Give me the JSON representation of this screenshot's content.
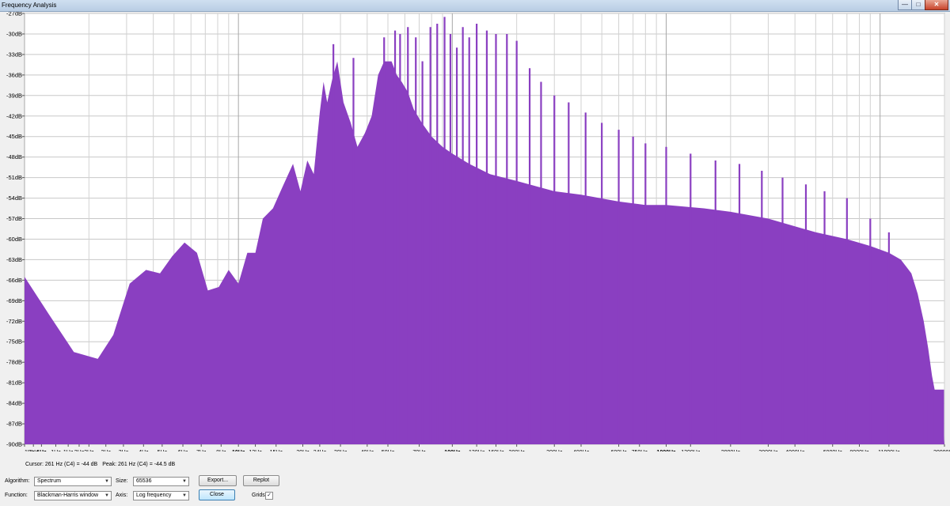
{
  "window": {
    "title": "Frequency Analysis",
    "controls": {
      "minimize": "—",
      "maximize": "□",
      "close": "✕"
    }
  },
  "chart_data": {
    "type": "area",
    "xscale": "log",
    "x_unit": "Hz",
    "y_unit": "dB",
    "ylim": [
      -90,
      -27
    ],
    "xlim": [
      1,
      20000
    ],
    "grid": true,
    "fill_color": "#8a3fc1",
    "y_ticks": [
      "-27dB",
      "-30dB",
      "-33dB",
      "-36dB",
      "-39dB",
      "-42dB",
      "-45dB",
      "-48dB",
      "-51dB",
      "-54dB",
      "-57dB",
      "-60dB",
      "-63dB",
      "-66dB",
      "-69dB",
      "-72dB",
      "-75dB",
      "-78dB",
      "-81dB",
      "-84dB",
      "-87dB",
      "-90dB"
    ],
    "x_ticks": [
      "1Hz",
      "1Hz",
      "1Hz",
      "1Hz",
      "1Hz",
      "2Hz",
      "2Hz",
      "2Hz",
      "3Hz",
      "4Hz",
      "5Hz",
      "6Hz",
      "7Hz",
      "8Hz",
      "10Hz",
      "12Hz",
      "15Hz",
      "20Hz",
      "24Hz",
      "30Hz",
      "40Hz",
      "50Hz",
      "70Hz",
      "100Hz",
      "130Hz",
      "160Hz",
      "200Hz",
      "300Hz",
      "400Hz",
      "600Hz",
      "750Hz",
      "1000Hz",
      "1300Hz",
      "2000Hz",
      "3000Hz",
      "4000Hz",
      "6000Hz",
      "8000Hz",
      "11000Hz",
      "20000Hz"
    ],
    "x_tick_values": [
      1.0,
      1.1,
      1.2,
      1.4,
      1.6,
      1.8,
      2.0,
      2.4,
      2.9,
      3.6,
      4.4,
      5.5,
      6.7,
      8.3,
      10,
      12,
      15,
      20,
      24,
      30,
      40,
      50,
      70,
      100,
      130,
      160,
      200,
      300,
      400,
      600,
      750,
      1000,
      1300,
      2000,
      3000,
      4000,
      6000,
      8000,
      11000,
      20000
    ],
    "x_tick_bold": [
      false,
      false,
      true,
      false,
      false,
      false,
      false,
      false,
      false,
      false,
      false,
      false,
      false,
      false,
      true,
      false,
      false,
      false,
      false,
      false,
      false,
      false,
      false,
      true,
      false,
      false,
      false,
      false,
      false,
      false,
      false,
      true,
      false,
      false,
      false,
      false,
      false,
      false,
      false,
      false
    ],
    "envelope": {
      "x": [
        1,
        1.3,
        1.7,
        2.2,
        2.6,
        3.1,
        3.7,
        4.3,
        4.9,
        5.6,
        6.4,
        7.2,
        8.1,
        9.0,
        10,
        11,
        12,
        13,
        14.5,
        16,
        18,
        19.5,
        21,
        22.5,
        24,
        25,
        26,
        27.5,
        29,
        31,
        33.5,
        36,
        39,
        42,
        45,
        48,
        52,
        55,
        58,
        62,
        66,
        72,
        80,
        90,
        100,
        120,
        150,
        200,
        300,
        400,
        600,
        800,
        1000,
        1500,
        2000,
        3000,
        5000,
        7000,
        9000,
        11000,
        12500,
        14000,
        15000,
        16000,
        16800,
        17500,
        18500,
        19500,
        20000
      ],
      "y": [
        -65.5,
        -71,
        -76.5,
        -77.5,
        -74,
        -66.5,
        -64.5,
        -65,
        -62.5,
        -60.5,
        -62,
        -67.5,
        -67,
        -64.5,
        -66.5,
        -62,
        -62,
        -57,
        -55.5,
        -52.5,
        -49,
        -53,
        -48.5,
        -50.5,
        -41.5,
        -37,
        -40,
        -36.5,
        -34,
        -40,
        -43,
        -46.5,
        -44.5,
        -42,
        -36,
        -34,
        -34,
        -36,
        -37,
        -38.5,
        -41,
        -43,
        -45,
        -46.5,
        -47.5,
        -49,
        -50.5,
        -51.5,
        -53,
        -53.5,
        -54.5,
        -55,
        -55,
        -55.5,
        -56,
        -57,
        -59,
        -60,
        -61,
        -62,
        -63,
        -65,
        -68,
        -72,
        -76,
        -80,
        -84,
        -86,
        -90
      ]
    },
    "peaks": {
      "x": [
        27.8,
        34.5,
        48,
        54,
        57,
        62,
        67.5,
        72.5,
        79,
        85,
        92,
        98,
        105,
        112,
        120,
        130,
        145,
        160,
        180,
        200,
        230,
        260,
        300,
        350,
        420,
        500,
        600,
        700,
        800,
        1000,
        1300,
        1700,
        2200,
        2800,
        3500,
        4500,
        5500,
        7000,
        9000,
        11000
      ],
      "y": [
        -31.5,
        -33.5,
        -30.5,
        -29.5,
        -30,
        -29,
        -30.5,
        -34,
        -29,
        -28.5,
        -27.5,
        -30,
        -32,
        -29,
        -30.5,
        -28.5,
        -29.5,
        -30,
        -30,
        -31,
        -35,
        -37,
        -39,
        -40,
        -41.5,
        -43,
        -44,
        -45,
        -46,
        -46.5,
        -47.5,
        -48.5,
        -49,
        -50,
        -51,
        -52,
        -53,
        -54,
        -57,
        -59
      ]
    },
    "tail_blocks": {
      "x": [
        [
          16000,
          16700
        ],
        [
          17800,
          19900
        ]
      ],
      "y": [
        -80.5,
        -82
      ]
    }
  },
  "status": {
    "cursor": "Cursor: 261 Hz (C4) = -44 dB",
    "peak": "Peak: 261 Hz (C4) = -44.5 dB"
  },
  "controls": {
    "algorithm_label": "Algorithm:",
    "algorithm_value": "Spectrum",
    "size_label": "Size:",
    "size_value": "65536",
    "export_label": "Export...",
    "replot_label": "Replot",
    "function_label": "Function:",
    "function_value": "Blackman-Harris window",
    "axis_label": "Axis:",
    "axis_value": "Log frequency",
    "close_label": "Close",
    "grids_label": "Grids",
    "grids_checked": true
  }
}
